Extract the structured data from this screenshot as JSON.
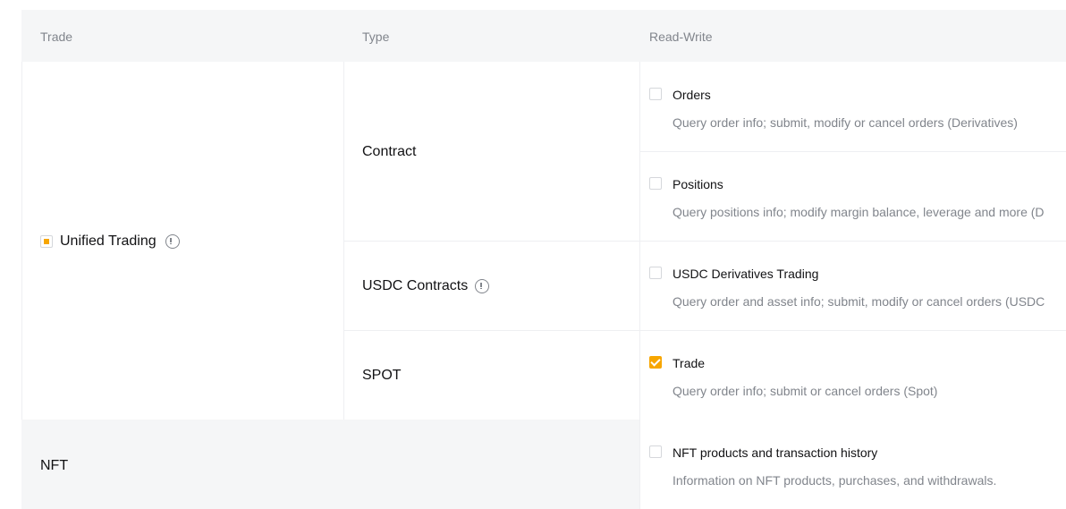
{
  "header": {
    "col_trade": "Trade",
    "col_type": "Type",
    "col_rw": "Read-Write"
  },
  "group": {
    "label": "Unified Trading",
    "checkbox_state": "partial",
    "info_icon": "info-circle-icon"
  },
  "types": [
    {
      "label": "Contract"
    },
    {
      "label": "USDC Contracts",
      "info_icon": "info-circle-icon"
    },
    {
      "label": "SPOT"
    }
  ],
  "permissions": [
    {
      "title": "Orders",
      "desc": "Query order info; submit, modify or cancel orders (Derivatives)",
      "checked": false
    },
    {
      "title": "Positions",
      "desc": "Query positions info; modify margin balance, leverage and more (D",
      "checked": false
    },
    {
      "title": "USDC Derivatives Trading",
      "desc": "Query order and asset info; submit, modify or cancel orders (USDC",
      "checked": false
    },
    {
      "title": "Trade",
      "desc": "Query order info; submit or cancel orders (Spot)",
      "checked": true
    }
  ],
  "nft": {
    "label": "NFT",
    "perm_title": "NFT products and transaction history",
    "perm_desc": "Information on NFT products, purchases, and withdrawals.",
    "checked": false
  },
  "colors": {
    "accent": "#f7a600",
    "header_bg": "#f5f6f7",
    "muted_text": "#81858c"
  }
}
